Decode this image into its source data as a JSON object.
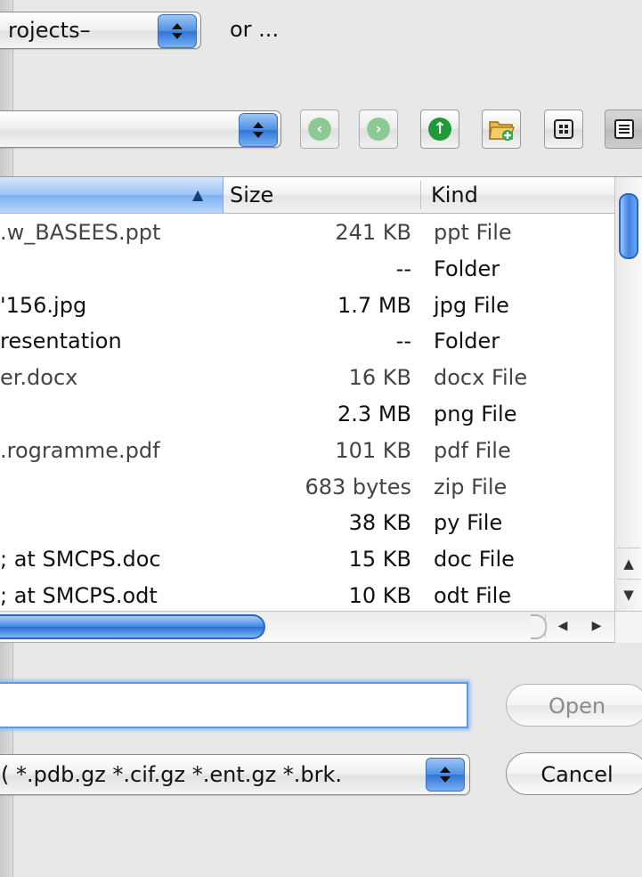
{
  "top_bar": {
    "location_popup": "rojects–",
    "or_label": "or ..."
  },
  "toolbar": {
    "path_popup": "",
    "buttons": [
      {
        "icon": "back-arrow-icon",
        "color": "#6fbf79"
      },
      {
        "icon": "forward-arrow-icon",
        "color": "#6fbf79"
      },
      {
        "icon": "up-arrow-icon",
        "color": "#1e9a3a"
      },
      {
        "icon": "new-folder-icon",
        "color": "#d9a83b"
      },
      {
        "icon": "icon-view-icon",
        "color": "#222222"
      },
      {
        "icon": "list-view-icon",
        "color": "#222222"
      }
    ]
  },
  "table": {
    "headers": {
      "name": "",
      "size": "Size",
      "kind": "Kind"
    },
    "sort_indicator": "▲",
    "rows": [
      {
        "name": ".w_BASEES.ppt",
        "size": "241 KB",
        "kind": "ppt File",
        "dim": true
      },
      {
        "name": "",
        "size": "--",
        "kind": "Folder",
        "dim": false
      },
      {
        "name": "'156.jpg",
        "size": "1.7 MB",
        "kind": "jpg File",
        "dim": false
      },
      {
        "name": "resentation",
        "size": "--",
        "kind": "Folder",
        "dim": false
      },
      {
        "name": "er.docx",
        "size": "16 KB",
        "kind": "docx File",
        "dim": true
      },
      {
        "name": "",
        "size": "2.3 MB",
        "kind": "png File",
        "dim": false
      },
      {
        "name": ".rogramme.pdf",
        "size": "101 KB",
        "kind": "pdf File",
        "dim": true
      },
      {
        "name": "",
        "size": "683 bytes",
        "kind": "zip File",
        "dim": true
      },
      {
        "name": "",
        "size": "38 KB",
        "kind": "py File",
        "dim": false
      },
      {
        "name": "; at SMCPS.doc",
        "size": "15 KB",
        "kind": "doc File",
        "dim": false
      },
      {
        "name": "; at SMCPS.odt",
        "size": "10 KB",
        "kind": "odt File",
        "dim": false
      }
    ]
  },
  "filename": {
    "value": ""
  },
  "format_popup": {
    "value": "( *.pdb.gz *.cif.gz *.ent.gz *.brk."
  },
  "buttons": {
    "open": "Open",
    "cancel": "Cancel"
  }
}
